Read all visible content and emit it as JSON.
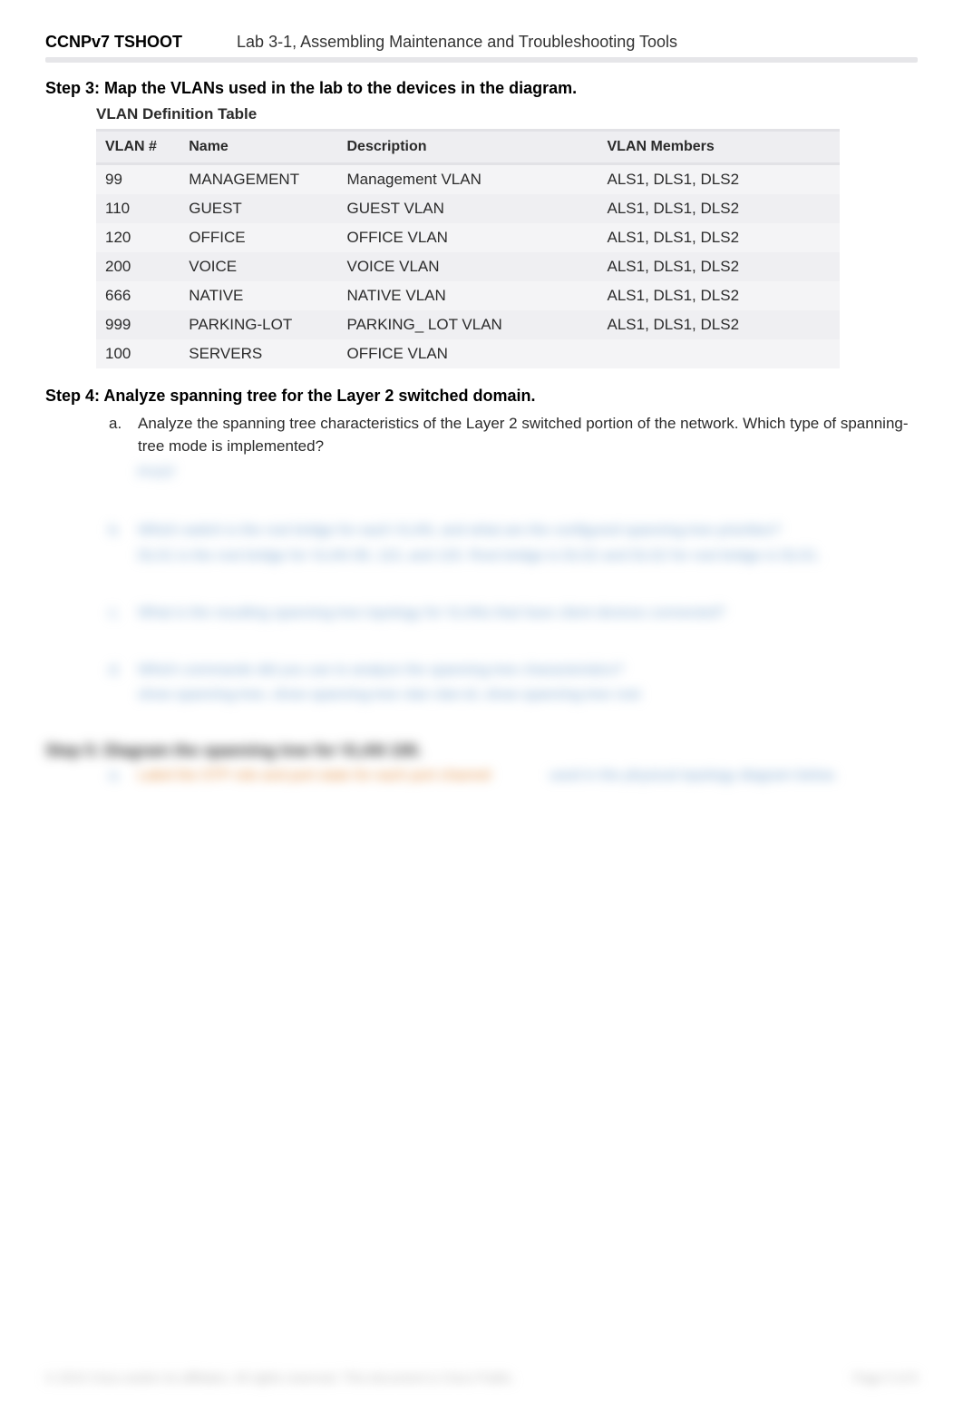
{
  "header": {
    "course": "CCNPv7 TSHOOT",
    "lab": "Lab 3-1, Assembling Maintenance and Troubleshooting Tools"
  },
  "step3": {
    "title": "Step 3: Map the VLANs used in the lab to the devices in the diagram.",
    "subtitle": "VLAN Definition Table",
    "columns": {
      "id": "VLAN #",
      "name": "Name",
      "desc": "Description",
      "mem": "VLAN Members"
    },
    "rows": [
      {
        "id": "99",
        "name": "MANAGEMENT",
        "desc": "Management VLAN",
        "mem": "ALS1, DLS1, DLS2"
      },
      {
        "id": "110",
        "name": "GUEST",
        "desc": "GUEST VLAN",
        "mem": "ALS1, DLS1, DLS2"
      },
      {
        "id": "120",
        "name": "OFFICE",
        "desc": "OFFICE VLAN",
        "mem": "ALS1, DLS1, DLS2"
      },
      {
        "id": "200",
        "name": "VOICE",
        "desc": "VOICE VLAN",
        "mem": "ALS1, DLS1, DLS2"
      },
      {
        "id": "666",
        "name": "NATIVE",
        "desc": "NATIVE VLAN",
        "mem": "ALS1, DLS1, DLS2"
      },
      {
        "id": "999",
        "name": "PARKING-LOT",
        "desc": "PARKING_ LOT VLAN",
        "mem": "ALS1, DLS1, DLS2"
      },
      {
        "id": "100",
        "name": "SERVERS",
        "desc": "OFFICE VLAN",
        "mem": ""
      }
    ]
  },
  "step4": {
    "title": "Step 4: Analyze spanning tree for the Layer 2 switched domain.",
    "qa": {
      "marker": "a.",
      "text": "Analyze the spanning tree characteristics of the Layer 2 switched portion of the network. Which type of spanning-tree mode is implemented?",
      "answer_blur": "PVST"
    },
    "qb": {
      "marker": "b.",
      "text_blur": "Which switch is the root bridge for each VLAN, and what are the configured spanning-tree priorities?",
      "answer_blur": "DLS1 is the root bridge for VLAN 99, 110, and 120. Root bridge is DLS2 and DLS2 for root bridge is DLS1."
    },
    "qc": {
      "marker": "c.",
      "text_blur": "What is the resulting spanning-tree topology for VLANs that have client devices connected?"
    },
    "qd": {
      "marker": "d.",
      "text_blur": "Which commands did you use to analyze the spanning-tree characteristics?",
      "answer_blur": "show spanning-tree, show spanning-tree vlan vlan-id, show spanning-tree root"
    }
  },
  "step5": {
    "title_blur": "Step 5: Diagram the spanning tree for VLAN 100.",
    "qa": {
      "marker": "a.",
      "orange_blur": "Label the STP role and port state for each port channel",
      "blue_blur": "used in the physical topology diagram below."
    }
  },
  "footer": {
    "left_blur": "© 2015 Cisco and/or its affiliates. All rights reserved. This document is Cisco Public.",
    "right_blur": "Page 5 of 8"
  }
}
